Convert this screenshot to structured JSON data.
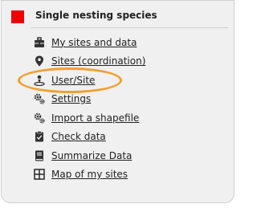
{
  "panel": {
    "title": "Single nesting species",
    "marker_color": "#ee0000",
    "highlight_color": "#f0a030",
    "items": [
      {
        "label": "My sites and data",
        "icon": "briefcase-icon"
      },
      {
        "label": "Sites (coordination)",
        "icon": "map-pin-icon"
      },
      {
        "label": "User/Site",
        "icon": "user-location-icon"
      },
      {
        "label": "Settings",
        "icon": "gears-icon"
      },
      {
        "label": "Import a shapefile",
        "icon": "gears-icon"
      },
      {
        "label": "Check data",
        "icon": "clipboard-check-icon"
      },
      {
        "label": "Summarize Data",
        "icon": "book-icon"
      },
      {
        "label": "Map of my sites",
        "icon": "grid-icon"
      }
    ]
  }
}
